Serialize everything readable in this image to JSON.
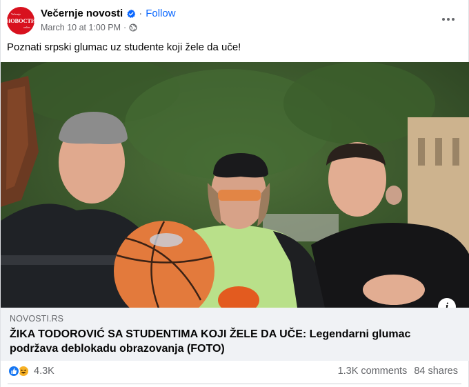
{
  "header": {
    "page_name": "Večernje novosti",
    "follow_label": "Follow",
    "timestamp": "March 10 at 1:00 PM",
    "meta_separator": "·",
    "avatar": {
      "small_text": "Večernje",
      "main_text": "НОВОСТИ",
      "sub_text": "online",
      "color": "#d8111e"
    },
    "verified_icon": "verified-badge-icon",
    "audience_icon": "globe-icon"
  },
  "post": {
    "text": "Poznati srpski glumac uz studente koji žele da uče!"
  },
  "photo": {
    "info_label": "i"
  },
  "link_preview": {
    "domain": "NOVOSTI.RS",
    "title": "ŽIKA TODOROVIĆ SA STUDENTIMA KOJI ŽELE DA UČE: Legendarni glumac podržava deblokadu obrazovanja (FOTO)"
  },
  "footer": {
    "reaction_count": "4.3K",
    "comments": "1.3K comments",
    "shares": "84 shares",
    "reaction_icons": [
      "like-icon",
      "haha-icon"
    ]
  },
  "colors": {
    "accent": "#0866ff",
    "verified": "#0866ff",
    "secondary_text": "#65676b",
    "link_box_bg": "#f0f2f5"
  }
}
